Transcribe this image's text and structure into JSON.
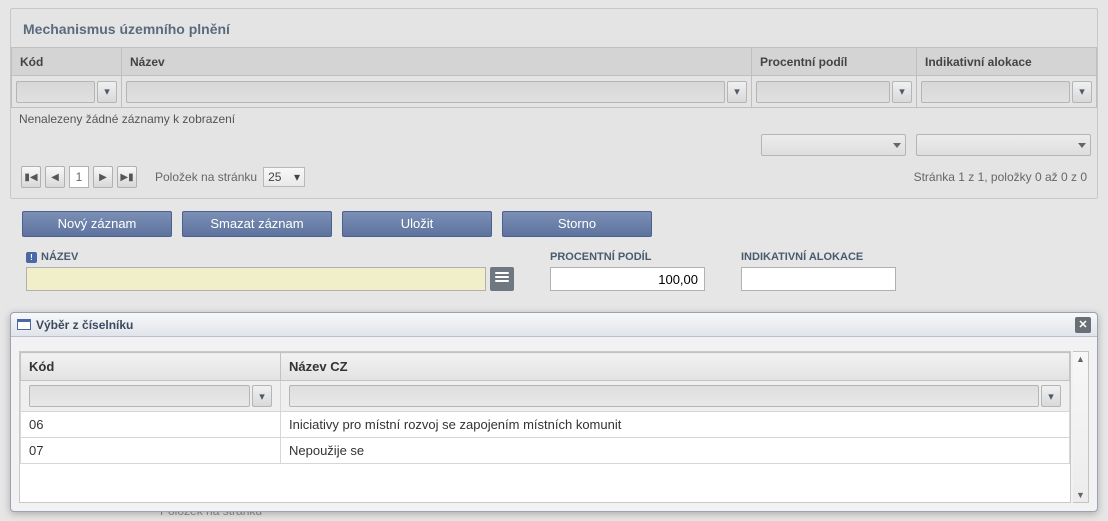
{
  "section": {
    "title": "Mechanismus územního plnění"
  },
  "cols": {
    "kod": "Kód",
    "nazev": "Název",
    "procentni": "Procentní podíl",
    "indik": "Indikativní alokace"
  },
  "no_records": "Nenalezeny žádné záznamy k zobrazení",
  "pager": {
    "current": "1",
    "items_per_page_label": "Položek na stránku",
    "items_per_page": "25",
    "info": "Stránka 1 z 1, položky 0 až 0 z 0"
  },
  "buttons": {
    "novy": "Nový záznam",
    "smazat": "Smazat záznam",
    "ulozit": "Uložit",
    "storno": "Storno"
  },
  "form": {
    "nazev_label": "NÁZEV",
    "procentni_label": "PROCENTNÍ PODÍL",
    "procentni_value": "100,00",
    "indik_label": "INDIKATIVNÍ ALOKACE"
  },
  "modal": {
    "title": "Výběr z číselníku",
    "col_kod": "Kód",
    "col_nazev": "Název CZ",
    "rows": [
      {
        "kod": "06",
        "nazev": "Iniciativy pro místní rozvoj se zapojením místních komunit"
      },
      {
        "kod": "07",
        "nazev": "Nepoužije se"
      }
    ]
  },
  "behind_text": "Položek na stránku"
}
